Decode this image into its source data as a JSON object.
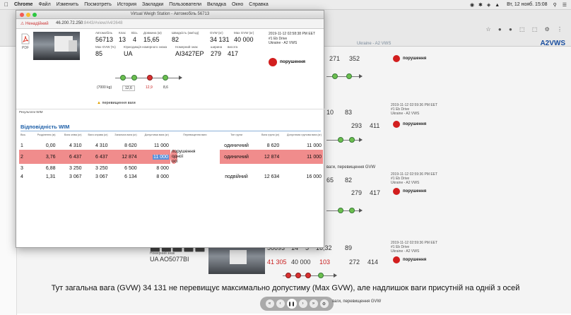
{
  "menubar": {
    "items": [
      "Chrome",
      "Файл",
      "Изменить",
      "Посмотреть",
      "История",
      "Закладки",
      "Пользователи",
      "Вкладка",
      "Окно",
      "Справка"
    ],
    "clock": "Вт, 12 нояб. 15:08"
  },
  "background": {
    "brand": "A2VWS",
    "region": "Ukraine - A2 VWS",
    "rows": [
      {
        "vals": [
          "271",
          "352"
        ],
        "viol": "порушення"
      },
      {
        "small": "GVW (кг)   Max GVW (кг)   Шасі (тон.)   Швидкість (км/год)",
        "vals": [
          "10",
          "83"
        ],
        "vals2": [
          "293",
          "411"
        ],
        "viol": "порушення",
        "note": "ваги, перевищення GVW"
      },
      {
        "vals": [
          "65",
          "82"
        ],
        "vals2": [
          "279",
          "417"
        ],
        "viol": "порушення"
      },
      {
        "vals": [
          "56693",
          "14",
          "5",
          "16,32",
          "89"
        ],
        "vals2": [
          "41 305",
          "40 000",
          "103",
          "272",
          "414"
        ],
        "viol": "порушення",
        "plate": "UA AO5077BI",
        "note": "ваги, перевищення GVW"
      }
    ],
    "timestamp": "2019-11-12 02:59:36 PM EET",
    "station": "#1 Eb Drive",
    "country": "Ukraine - A2 VWS"
  },
  "window": {
    "title": "Virtual Weigh Station - Автомобіль 56713",
    "warn": "Ненадійний",
    "url": "46.200.72.250",
    "url_rest": ":8443/#view/A4/2648",
    "pdf_label": "PDF",
    "vehicle": {
      "labels": {
        "auto": "Автомобіль",
        "class": "Клас",
        "axles": "Вісь",
        "length": "Довжина (м)",
        "speed": "Швидкість (км/год)",
        "gvw": "GVW (кг)",
        "maxgvw": "Max GVW (кг)",
        "maxgvwpct": "Max GVW (%)",
        "country": "Юрисдикція номерного знака",
        "plate": "Номерний знак",
        "width": "ширина",
        "height": "висота"
      },
      "auto": "56713",
      "class": "13",
      "axles": "4",
      "length": "15,65",
      "speed": "82",
      "gvw": "34 131",
      "maxgvw": "40 000",
      "maxgvwpct": "85",
      "country": "UA",
      "plate": "AI3427EP",
      "width": "279",
      "height": "417",
      "timestamp": "2019-11-12 02:58:38 PM EET",
      "station": "#1 Eb Drive",
      "region": "Ukraine - A2 VWS",
      "violation": "порушення"
    },
    "axle_diagram": {
      "label_left": "(7000 kg)",
      "box": "12,6",
      "red": "12,9",
      "right": "8,6"
    },
    "overweight": "перевищення ваги",
    "tab": "Результати WIM",
    "section": "Відповідність WIM",
    "table": {
      "headers": [
        "Вісь",
        "Розділення (м)",
        "Вага зліва (кг)",
        "Вага справа (кг)",
        "Загальна вага (кг)",
        "Допустима вага (кг)",
        "Перевищення ваги",
        "Тип групи",
        "Вага групи (кг)",
        "Допустима групова вага (кг)"
      ],
      "rows": [
        [
          "1",
          "0,00",
          "4 310",
          "4 310",
          "8 620",
          "11 000",
          "",
          "одиничний",
          "8 620",
          "11 000"
        ],
        [
          "2",
          "3,76",
          "6 437",
          "6 437",
          "12 874",
          "11 000",
          "порушення одної осі",
          "одиничний",
          "12 874",
          "11 000"
        ],
        [
          "3",
          "6,88",
          "3 250",
          "3 250",
          "6 500",
          "8 000",
          "",
          "",
          "",
          ""
        ],
        [
          "4",
          "1,31",
          "3 067",
          "3 067",
          "6 134",
          "8 000",
          "",
          "подвійний",
          "12 634",
          "16 000"
        ]
      ]
    }
  },
  "subtitle": "Тут загальна вага (GVW) 34 131 не перевищує максимально допустиму (Max GVW), але надлишок ваги  присутній на одній з осей",
  "player": {
    "buttons": [
      "back",
      "prev",
      "play",
      "next",
      "fwd",
      "settings"
    ]
  }
}
